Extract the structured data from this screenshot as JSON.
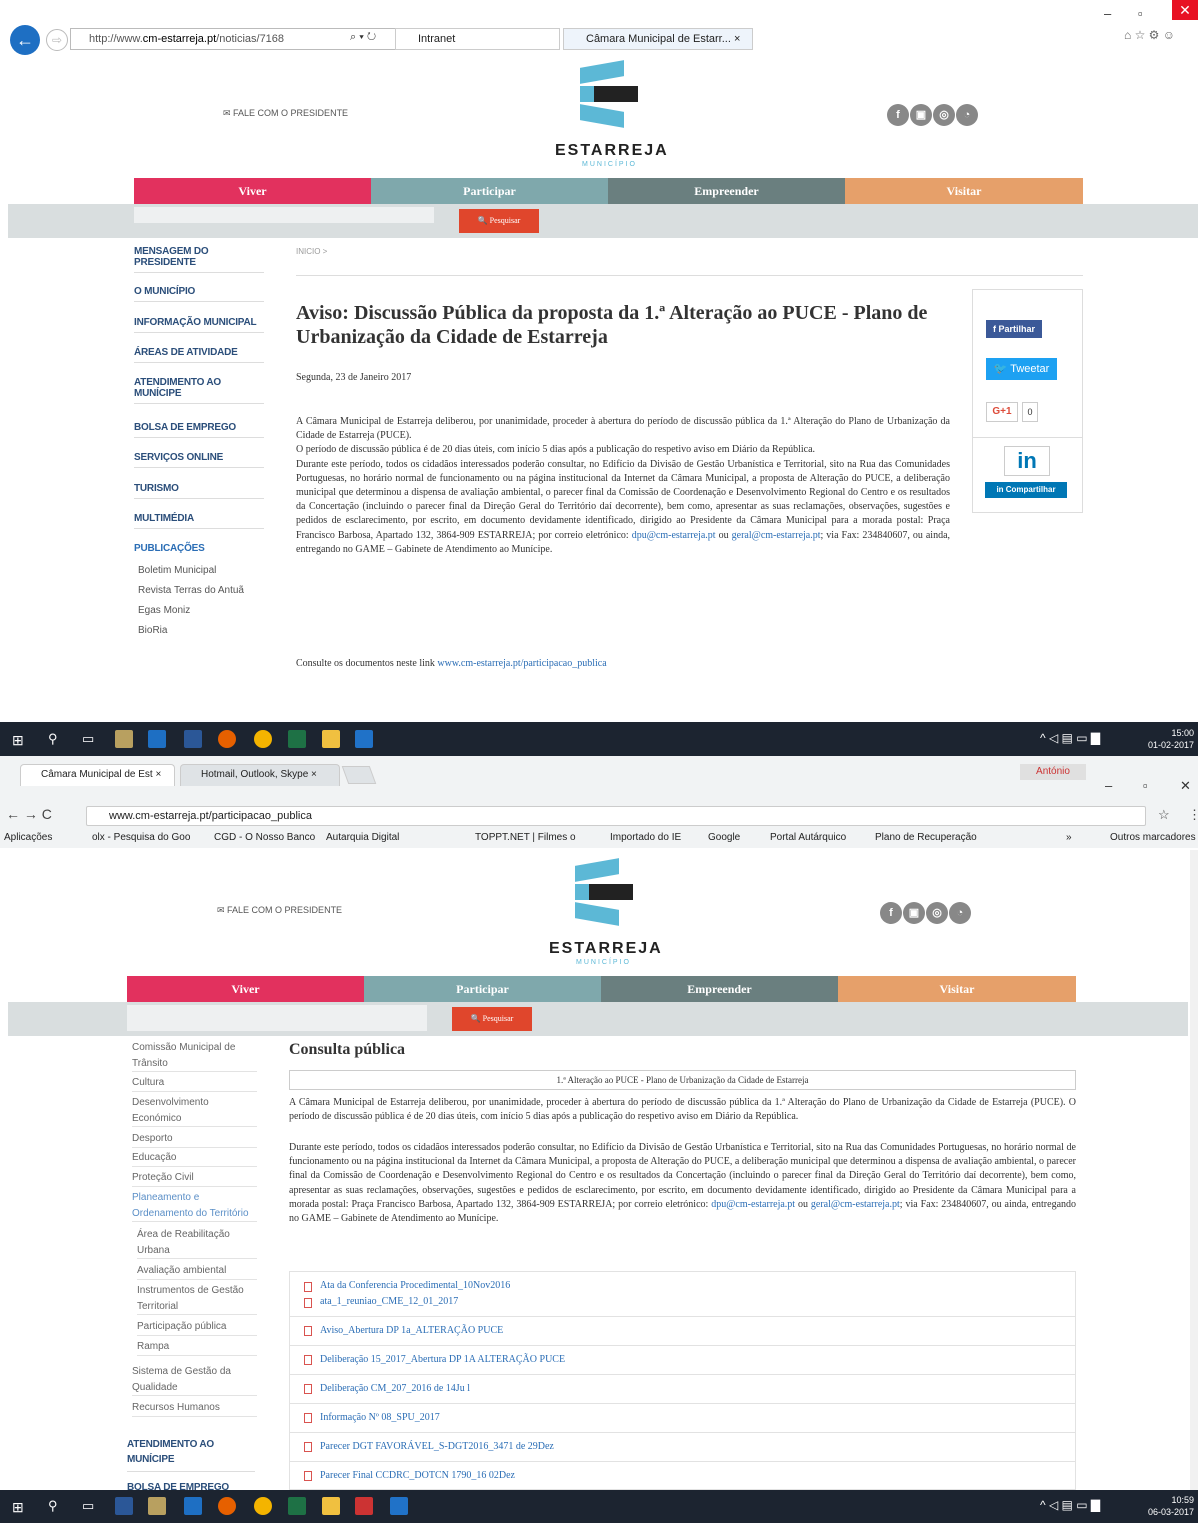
{
  "ie": {
    "url_prefix": "http://www.",
    "url_domain": "cm-estarreja.pt",
    "url_path": "/noticias/7168",
    "tab_intranet": "Intranet",
    "tab_active": "Câmara Municipal de Estarr... ×",
    "search_icons": "⌕ ▾ ↻"
  },
  "header": {
    "fale": "✉ FALE COM O PRESIDENTE",
    "logo_text": "ESTARREJA",
    "logo_sub": "MUNICÍPIO",
    "social": [
      "f",
      "▣",
      "◎",
      "◔"
    ]
  },
  "nav": {
    "items": [
      {
        "label": "Viver",
        "color": "#e2315e"
      },
      {
        "label": "Participar",
        "color": "#7fa8ac"
      },
      {
        "label": "Empreender",
        "color": "#6a7f7f"
      },
      {
        "label": "Visitar",
        "color": "#e6a06a"
      }
    ],
    "search_button": "🔍 Pesquisar"
  },
  "sidebar1": {
    "items": [
      "MENSAGEM DO PRESIDENTE",
      "O MUNICÍPIO",
      "INFORMAÇÃO MUNICIPAL",
      "ÁREAS DE ATIVIDADE",
      "ATENDIMENTO AO MUNÍCIPE",
      "BOLSA DE EMPREGO",
      "SERVIÇOS ONLINE",
      "TURISMO",
      "MULTIMÉDIA",
      "PUBLICAÇÕES"
    ],
    "subitems": [
      "Boletim Municipal",
      "Revista Terras do Antuã",
      "Egas Moniz",
      "BioRia"
    ]
  },
  "article": {
    "breadcrumb": "INICIO >",
    "title": "Aviso: Discussão Pública da proposta da 1.ª Alteração ao PUCE - Plano de Urbanização da Cidade de Estarreja",
    "date": "Segunda, 23 de Janeiro 2017",
    "p1": "A Câmara Municipal de Estarreja deliberou, por unanimidade, proceder à abertura do período de discussão pública da 1.ª Alteração do Plano de Urbanização da Cidade de Estarreja (PUCE).",
    "p2": "O período de discussão pública é de 20 dias úteis, com início 5 dias após a publicação do respetivo aviso em Diário da República.",
    "p3a": "Durante este período, todos os cidadãos interessados poderão consultar, no Edifício da Divisão de Gestão Urbanística e Territorial, sito na Rua das Comunidades Portuguesas, no horário normal de funcionamento ou na página institucional da Internet da Câmara Municipal, a proposta de Alteração do PUCE, a deliberação municipal que determinou a dispensa de avaliação ambiental, o parecer final da Comissão de Coordenação e Desenvolvimento Regional do Centro e os resultados da Concertação (incluindo o parecer final da Direção Geral do Território daí decorrente), bem como, apresentar as suas reclamações, observações, sugestões e pedidos de esclarecimento, por escrito, em documento devidamente identificado, dirigido ao Presidente da Câmara Municipal para a morada postal: Praça Francisco Barbosa, Apartado 132, 3864-909 ESTARREJA; por correio eletrónico: ",
    "email1": "dpu@cm-estarreja.pt",
    "ou": " ou ",
    "email2": "geral@cm-estarreja.pt",
    "p3b": "; via Fax: 234840607, ou ainda, entregando no GAME – Gabinete de Atendimento ao Munícipe.",
    "consulte": "Consulte os documentos neste link ",
    "link": "www.cm-estarreja.pt/participacao_publica"
  },
  "share": {
    "partilhar": "f Partilhar",
    "tweetar": "🐦 Tweetar",
    "gplus": "G+1",
    "gcount": "0",
    "in": "in",
    "compartilhar": "in Compartilhar"
  },
  "taskbar1": {
    "time": "15:00",
    "date": "01-02-2017"
  },
  "chrome": {
    "tab1": "Câmara Municipal de Est ×",
    "tab2": "Hotmail, Outlook, Skype ×",
    "user": "António",
    "url": "www.cm-estarreja.pt/participacao_publica",
    "bookmarks": [
      "Aplicações",
      "olx - Pesquisa do Goo",
      "CGD - O Nosso Banco",
      "Autarquia Digital",
      "",
      "TOPPT.NET | Filmes o",
      "Importado do IE",
      "Google",
      "Portal Autárquico",
      "Plano de Recuperação"
    ],
    "more": "»",
    "others": "Outros marcadores"
  },
  "sidebar2": {
    "items": [
      "Comissão Municipal de Trânsito",
      "Cultura",
      "Desenvolvimento Económico",
      "Desporto",
      "Educação",
      "Proteção Civil",
      "Planeamento e Ordenamento do Território"
    ],
    "subitems": [
      "Área de Reabilitação Urbana",
      "Avaliação ambiental",
      "Instrumentos de Gestão Territorial",
      "Participação pública",
      "Rampa"
    ],
    "items2": [
      "Sistema de Gestão da Qualidade",
      "Recursos Humanos"
    ],
    "bold": [
      "ATENDIMENTO AO MUNÍCIPE",
      "BOLSA DE EMPREGO"
    ]
  },
  "consulta": {
    "title": "Consulta pública",
    "box": "1.ª Alteração ao PUCE - Plano de Urbanização da Cidade de Estarreja",
    "p1": "A Câmara Municipal de Estarreja deliberou, por unanimidade, proceder à abertura do período de discussão pública da 1.ª Alteração do Plano de Urbanização da Cidade de Estarreja (PUCE). O período de discussão pública é de 20 dias úteis, com início 5 dias após a publicação do respetivo aviso em Diário da República.",
    "p2a": "Durante este período, todos os cidadãos interessados poderão consultar, no Edifício da Divisão de Gestão Urbanística e Territorial, sito na Rua das Comunidades Portuguesas, no horário normal de funcionamento ou na página institucional da Internet da Câmara Municipal, a proposta de Alteração do PUCE, a deliberação municipal que determinou a dispensa de avaliação ambiental, o parecer final da Comissão de Coordenação e Desenvolvimento Regional do Centro e os resultados da Concertação (incluindo o parecer final da Direção Geral do Território daí decorrente), bem como, apresentar as suas reclamações, observações, sugestões e pedidos de esclarecimento, por escrito, em documento devidamente identificado, dirigido ao Presidente da Câmara Municipal para a morada postal: Praça Francisco Barbosa, Apartado 132, 3864-909 ESTARREJA; por correio eletrónico: ",
    "email1": "dpu@cm-estarreja.pt",
    "ou": " ou ",
    "email2": "geral@cm-estarreja.pt",
    "p2b": "; via Fax: 234840607, ou ainda, entregando no GAME – Gabinete de Atendimento ao Munícipe.",
    "docs": [
      "Ata da Conferencia Procedimental_10Nov2016",
      "ata_1_reuniao_CME_12_01_2017",
      "Aviso_Abertura DP 1a_ALTERAÇÃO PUCE",
      "Deliberação 15_2017_Abertura DP 1A ALTERAÇÃO PUCE",
      "Deliberação CM_207_2016 de 14Ju l",
      "Informação Nº 08_SPU_2017",
      "Parecer DGT FAVORÁVEL_S-DGT2016_3471 de 29Dez",
      "Parecer Final CCDRC_DOTCN 1790_16 02Dez"
    ]
  },
  "taskbar2": {
    "time": "10:59",
    "date": "06-03-2017"
  }
}
